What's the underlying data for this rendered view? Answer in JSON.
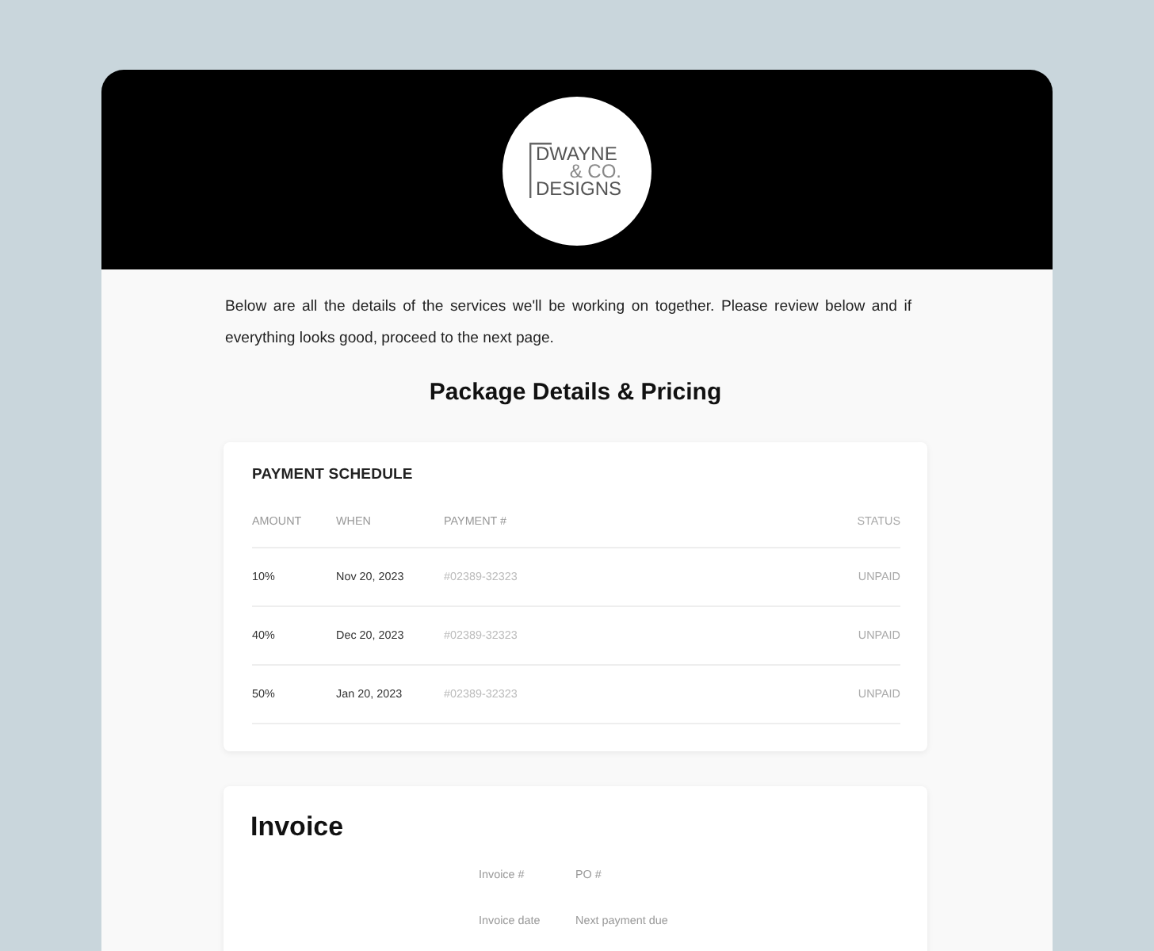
{
  "logo": {
    "lines": [
      "DWAYNE",
      "& CO.",
      "DESIGNS"
    ]
  },
  "intro": "Below are all the details of the services we'll be working on together. Please review below and if everything looks good, proceed to the next page.",
  "section_title": "Package Details & Pricing",
  "payment_schedule": {
    "title": "PAYMENT SCHEDULE",
    "columns": [
      "AMOUNT",
      "WHEN",
      "PAYMENT #",
      "STATUS"
    ],
    "rows": [
      {
        "amount": "10%",
        "when": "Nov 20, 2023",
        "payment": "#02389-32323",
        "status": "UNPAID"
      },
      {
        "amount": "40%",
        "when": "Dec 20, 2023",
        "payment": "#02389-32323",
        "status": "UNPAID"
      },
      {
        "amount": "50%",
        "when": "Jan 20, 2023",
        "payment": "#02389-32323",
        "status": "UNPAID"
      }
    ]
  },
  "invoice": {
    "title": "Invoice",
    "fields": [
      "Invoice #",
      "PO #",
      "Invoice date",
      "Next payment due"
    ]
  }
}
